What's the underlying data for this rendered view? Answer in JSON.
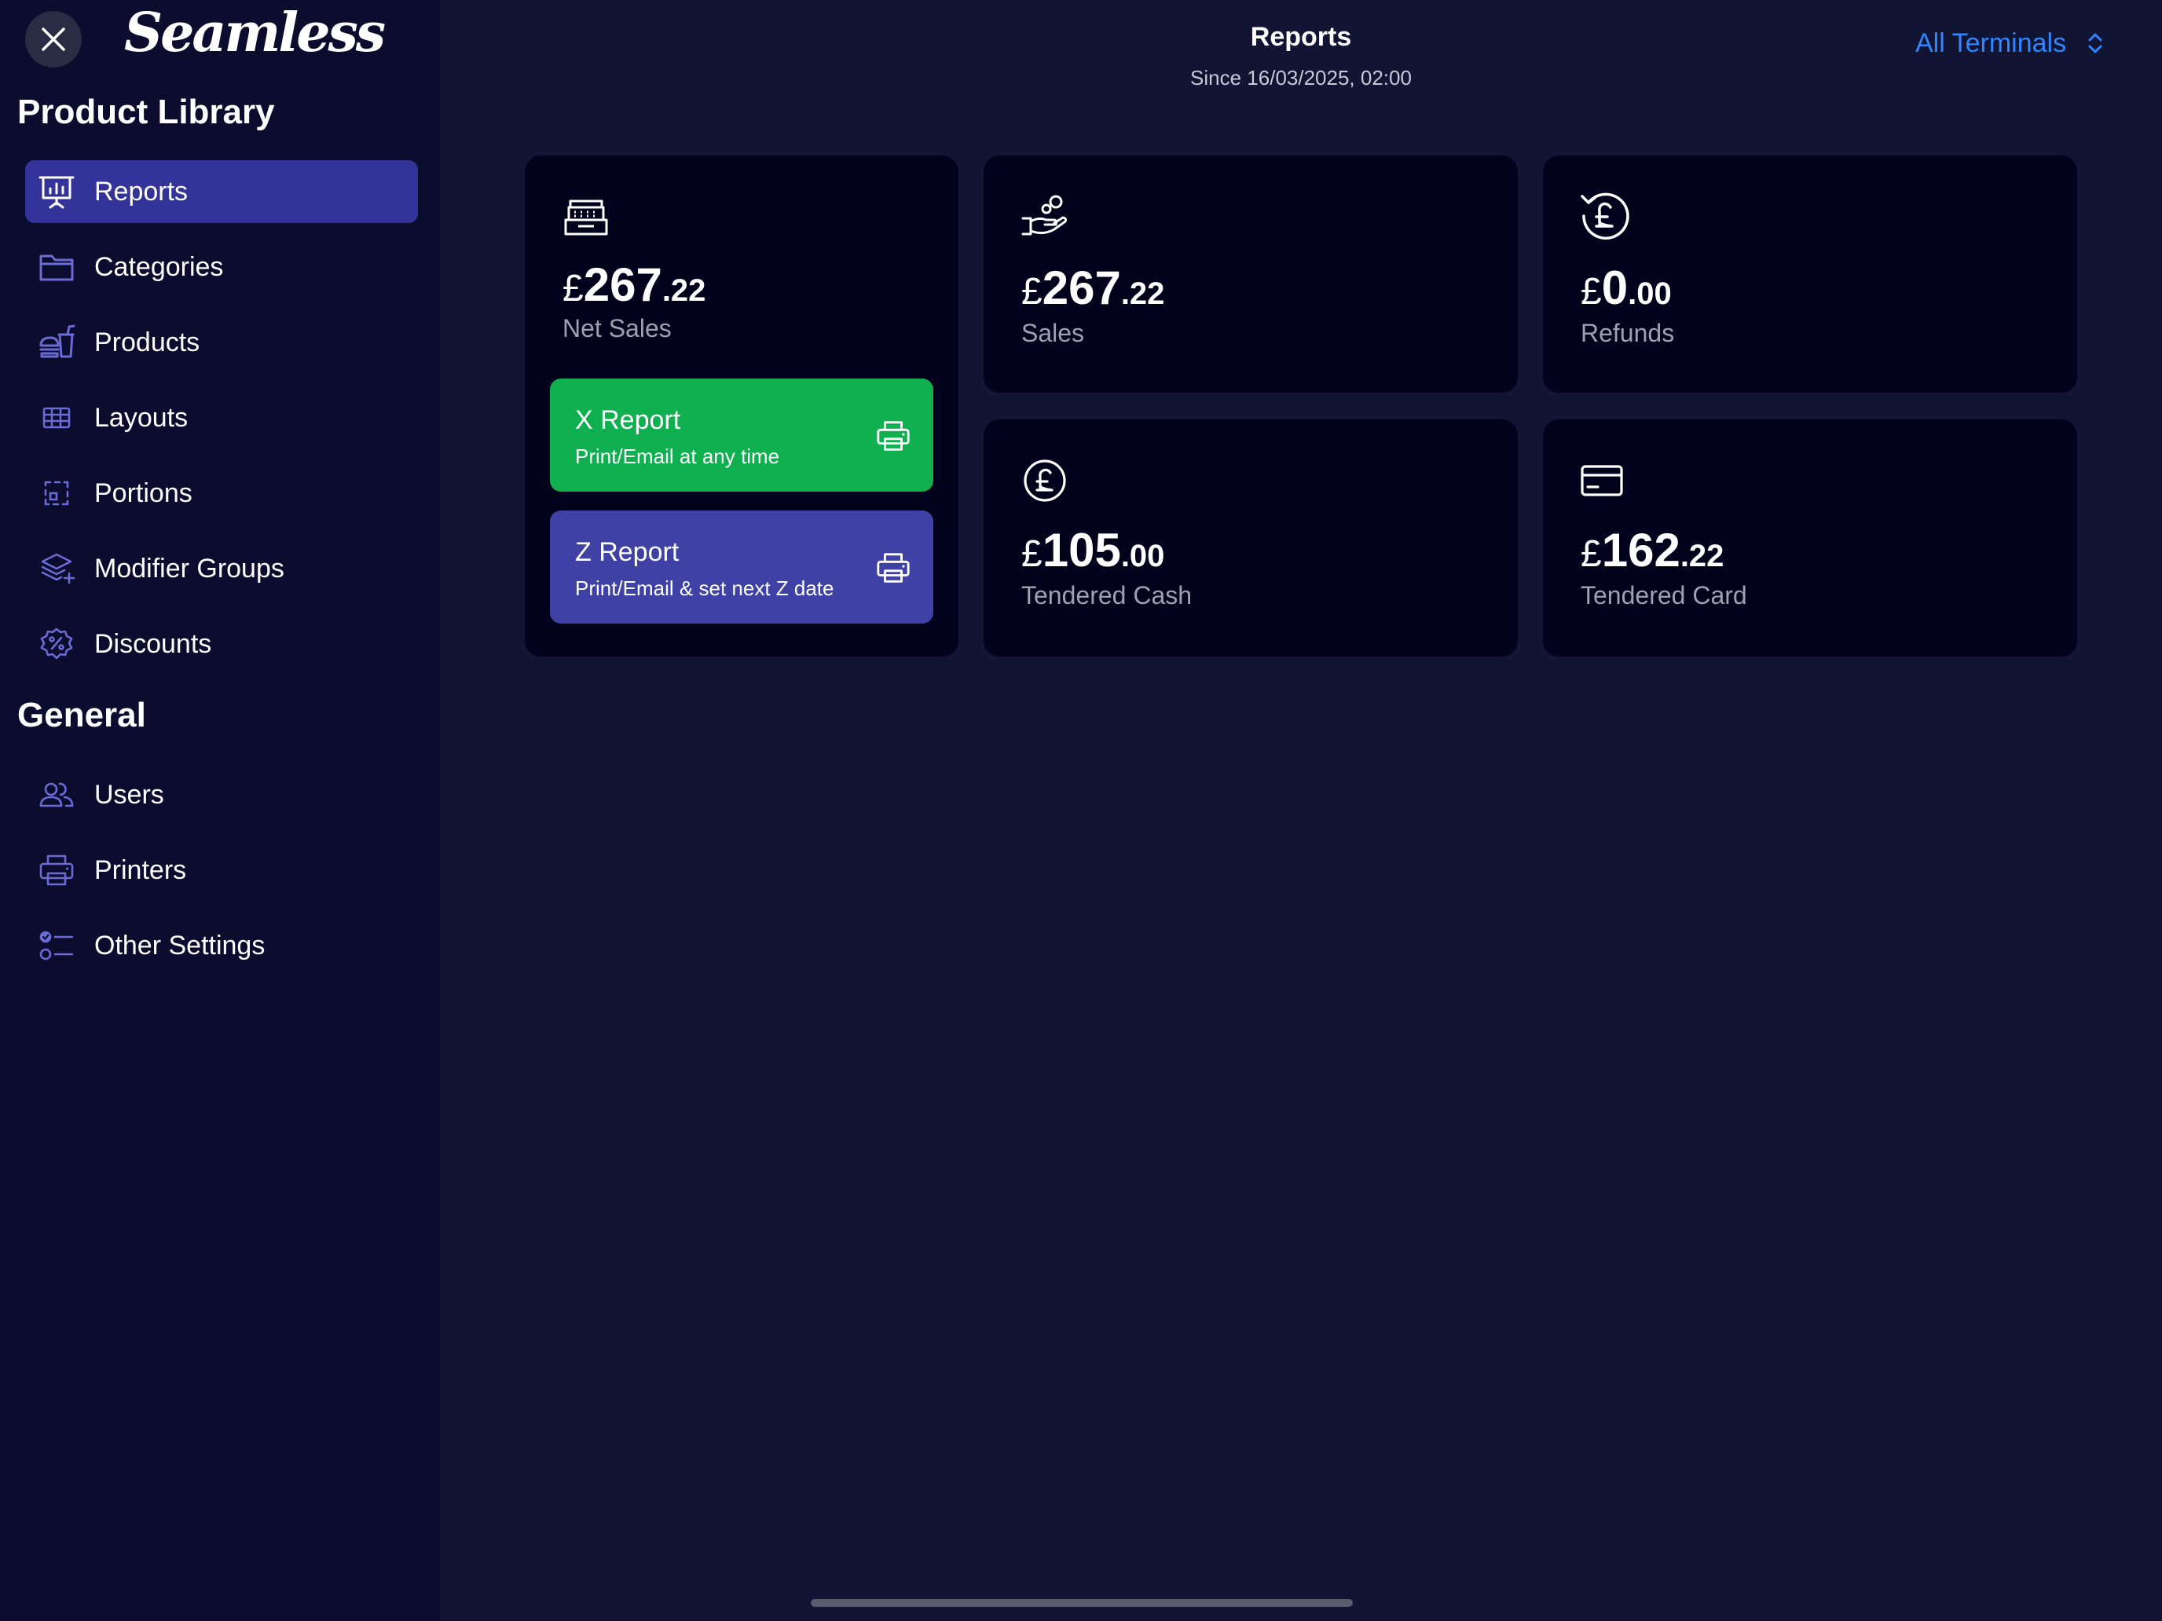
{
  "app": {
    "brand": "Seamless"
  },
  "sidebar": {
    "sections": [
      {
        "title": "Product Library",
        "items": [
          {
            "label": "Reports",
            "icon": "presentation-chart-icon",
            "active": true
          },
          {
            "label": "Categories",
            "icon": "folder-icon"
          },
          {
            "label": "Products",
            "icon": "burger-drink-icon"
          },
          {
            "label": "Layouts",
            "icon": "grid-table-icon"
          },
          {
            "label": "Portions",
            "icon": "portion-icon"
          },
          {
            "label": "Modifier Groups",
            "icon": "layers-icon"
          },
          {
            "label": "Discounts",
            "icon": "discount-badge-icon"
          }
        ]
      },
      {
        "title": "General",
        "items": [
          {
            "label": "Users",
            "icon": "users-icon"
          },
          {
            "label": "Printers",
            "icon": "printer-icon"
          },
          {
            "label": "Other Settings",
            "icon": "checklist-icon"
          }
        ]
      }
    ]
  },
  "header": {
    "title": "Reports",
    "subtitle": "Since 16/03/2025, 02:00",
    "terminal_select": "All Terminals"
  },
  "cards": {
    "net_sales": {
      "currency": "£",
      "major": "267",
      "minor": ".22",
      "label": "Net Sales",
      "icon": "cash-register-icon"
    },
    "sales": {
      "currency": "£",
      "major": "267",
      "minor": ".22",
      "label": "Sales",
      "icon": "hand-coins-icon"
    },
    "refunds": {
      "currency": "£",
      "major": "0",
      "minor": ".00",
      "label": "Refunds",
      "icon": "pound-refund-icon"
    },
    "tendered_cash": {
      "currency": "£",
      "major": "105",
      "minor": ".00",
      "label": "Tendered Cash",
      "icon": "pound-coin-icon"
    },
    "tendered_card": {
      "currency": "£",
      "major": "162",
      "minor": ".22",
      "label": "Tendered Card",
      "icon": "credit-card-icon"
    }
  },
  "reports": {
    "x": {
      "title": "X Report",
      "desc": "Print/Email at any time",
      "color": "#10b050"
    },
    "z": {
      "title": "Z Report",
      "desc": "Print/Email & set next Z date",
      "color": "#3f42a4"
    }
  },
  "colors": {
    "background": "#111433",
    "sidebar": "#0b0c2e",
    "card": "#02021c",
    "accent_blue": "#2f86ff",
    "active_item": "#33339a",
    "icon_purple": "#6b6bd6"
  }
}
